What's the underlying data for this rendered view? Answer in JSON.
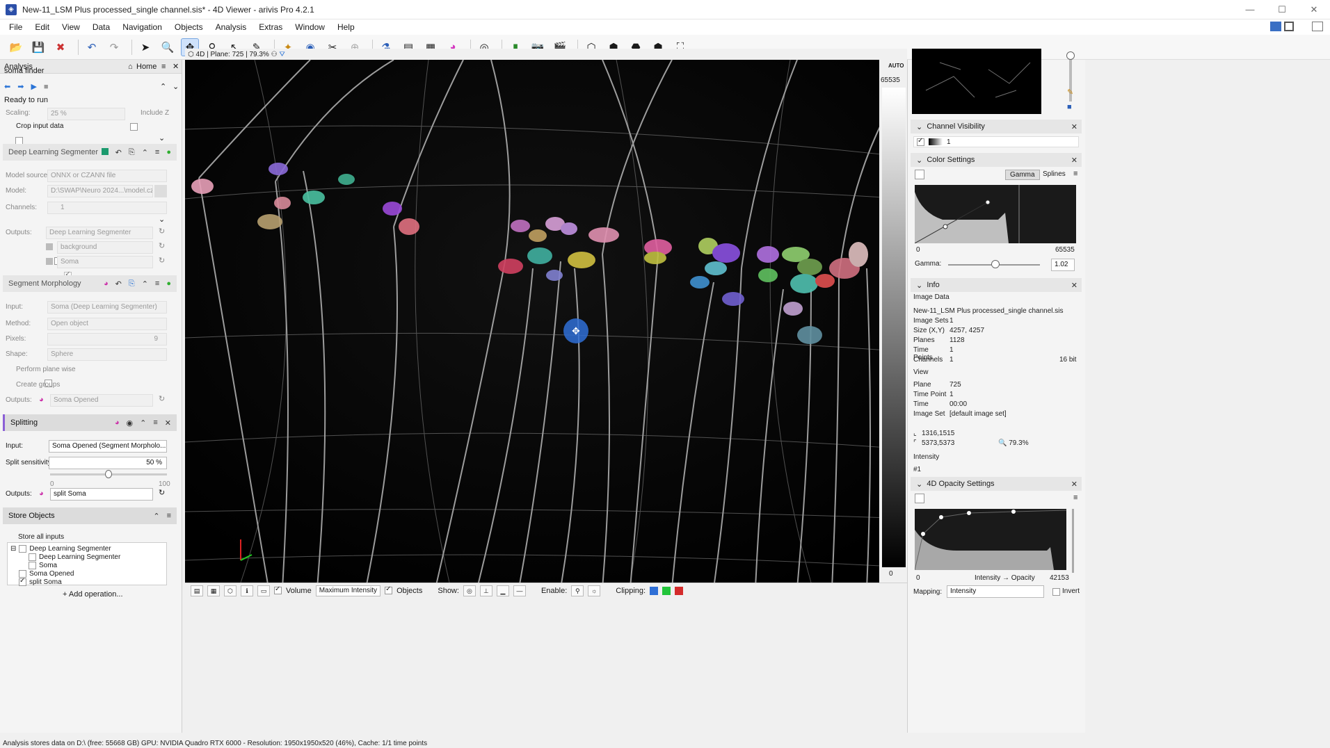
{
  "window": {
    "title": "New-11_LSM Plus processed_single channel.sis* - 4D Viewer - arivis Pro 4.2.1",
    "controls": [
      "—",
      "☐",
      "✕"
    ]
  },
  "menu": [
    "File",
    "Edit",
    "View",
    "Data",
    "Navigation",
    "Objects",
    "Analysis",
    "Extras",
    "Window",
    "Help"
  ],
  "toolbar_icons": [
    "open-icon",
    "save-icon",
    "close-file-icon",
    "undo-icon",
    "redo-icon",
    "pointer-icon",
    "zoom-icon",
    "pan-icon",
    "pick-icon",
    "select-icon",
    "draw-icon",
    "magic-wand-icon",
    "segment-icon",
    "split-icon",
    "merge-icon",
    "flask-icon",
    "table-icon",
    "chart-icon",
    "color-icon",
    "snapshot-icon",
    "bookmark-icon",
    "camera-icon",
    "movie-icon",
    "cube-icon",
    "cube2-icon",
    "cube3-icon",
    "cube4-icon",
    "fit-icon"
  ],
  "left_panel": {
    "title": "Analysis",
    "home_label": "Home",
    "pipeline_name": "soma finder",
    "status": "Ready to run",
    "scaling_label": "Scaling:",
    "scaling_value": "25 %",
    "include_z_label": "Include Z",
    "crop_label": "Crop input data",
    "dl_segmenter": {
      "title": "Deep Learning Segmenter",
      "model_source_label": "Model source:",
      "model_source_value": "ONNX or CZANN file",
      "model_label": "Model:",
      "model_value": "D:\\SWAP\\Neuro 2024...\\model.czann",
      "channels_label": "Channels:",
      "channels_value": "1",
      "outputs_label": "Outputs:",
      "outputs_value": "Deep Learning Segmenter",
      "class_background": "background",
      "class_soma": "Soma"
    },
    "morphology": {
      "title": "Segment Morphology",
      "input_label": "Input:",
      "input_value": "Soma (Deep Learning Segmenter)",
      "method_label": "Method:",
      "method_value": "Open object",
      "pixels_label": "Pixels:",
      "pixels_value": "9",
      "shape_label": "Shape:",
      "shape_value": "Sphere",
      "plane_wise_label": "Perform plane wise",
      "create_groups_label": "Create groups",
      "outputs_label": "Outputs:",
      "outputs_value": "Soma Opened"
    },
    "splitting": {
      "title": "Splitting",
      "input_label": "Input:",
      "input_value": "Soma Opened (Segment Morpholo...",
      "sensitivity_label": "Split sensitivity:",
      "sensitivity_value": "50 %",
      "sensitivity_level": 50,
      "slider_min": "0",
      "slider_max": "100",
      "outputs_label": "Outputs:",
      "outputs_value": "split Soma"
    },
    "store": {
      "title": "Store Objects",
      "store_all_label": "Store all inputs",
      "tree": [
        {
          "label": "Deep Learning Segmenter",
          "checked": false
        },
        {
          "label": "Deep Learning Segmenter",
          "checked": false
        },
        {
          "label": "Soma",
          "checked": false
        },
        {
          "label": "Soma Opened",
          "checked": false
        },
        {
          "label": "split Soma",
          "checked": true
        }
      ],
      "add_label": "+ Add operation..."
    }
  },
  "viewer": {
    "mode": "4D",
    "plane_label": "Plane: 725",
    "zoom": "79.3%",
    "lut_auto": "AUTO",
    "lut_max": "65535",
    "lut_min": "0"
  },
  "viewer_bottom": {
    "volume_label": "Volume",
    "render_mode": "Maximum Intensity",
    "objects_label": "Objects",
    "show_label": "Show:",
    "enable_label": "Enable:",
    "clipping_label": "Clipping:",
    "clip_colors": [
      "#2f6fd6",
      "#22c43a",
      "#d42b2b"
    ]
  },
  "right_panel": {
    "channel_visibility": {
      "title": "Channel Visibility",
      "channel": "1"
    },
    "color_settings": {
      "title": "Color Settings",
      "gamma_tab": "Gamma",
      "splines_tab": "Splines",
      "min": "0",
      "max": "65535",
      "gamma_label": "Gamma:",
      "gamma_value": "1.02"
    },
    "info": {
      "title": "Info",
      "image_data_label": "Image Data",
      "filename": "New-11_LSM Plus processed_single channel.sis",
      "rows": [
        {
          "k": "Image Sets",
          "v": "1"
        },
        {
          "k": "Size (X,Y)",
          "v": "4257, 4257"
        },
        {
          "k": "Planes",
          "v": "1128"
        },
        {
          "k": "Time Points",
          "v": "1"
        },
        {
          "k": "Channels",
          "v": "1"
        }
      ],
      "bit_depth": "16 bit",
      "view_label": "View",
      "view_rows": [
        {
          "k": "Plane",
          "v": "725"
        },
        {
          "k": "Time Point",
          "v": "1"
        },
        {
          "k": "Time",
          "v": "00:00"
        },
        {
          "k": "Image Set",
          "v": "[default image set]"
        }
      ],
      "cursor_pos": "1316,1515",
      "extent": "5373,5373",
      "zoom": "79.3%",
      "intensity_label": "Intensity",
      "intensity_value": "#1"
    },
    "opacity": {
      "title": "4D Opacity Settings",
      "min": "0",
      "axis_label": "Intensity → Opacity",
      "max": "42153",
      "mapping_label": "Mapping:",
      "mapping_value": "Intensity",
      "invert_label": "Invert"
    }
  },
  "statusbar": "Analysis stores data on D:\\ (free: 55668 GB)  GPU: NVIDIA Quadro RTX 6000 - Resolution: 1950x1950x520 (46%), Cache: 1/1 time points"
}
